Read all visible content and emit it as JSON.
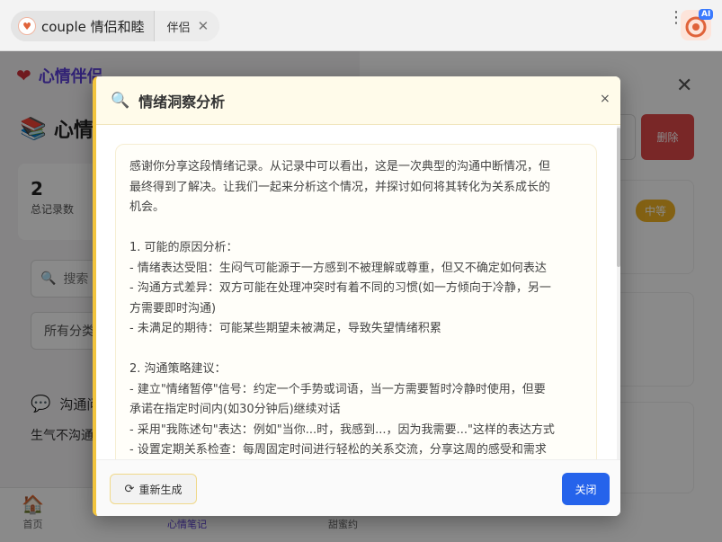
{
  "browser": {
    "tab_title": "couple 情侣和睦",
    "tab2_label": "伴侣",
    "tab_close_glyph": "✕",
    "menu_glyph": "⋮",
    "ai_badge": "AI"
  },
  "app": {
    "brand": "心情伴侣",
    "page_heading": "心情",
    "stats": {
      "total_value": "2",
      "total_label": "总记录数"
    },
    "search_placeholder": "搜索",
    "filter_value": "所有分类",
    "entry": {
      "title": "沟通问",
      "preview": "生气不沟通"
    },
    "nav": {
      "home": "首页",
      "notes": "心情笔记",
      "sweet": "甜蜜约"
    },
    "delete_label": "删除",
    "level_badge": "中等"
  },
  "modal": {
    "title": "情绪洞察分析",
    "close_glyph": "×",
    "paragraphs": [
      "感谢你分享这段情绪记录。从记录中可以看出，这是一次典型的沟通中断情况，但",
      "最终得到了解决。让我们一起来分析这个情况，并探讨如何将其转化为关系成长的",
      "机会。",
      "",
      "1. 可能的原因分析：",
      "- 情绪表达受阻：生闷气可能源于一方感到不被理解或尊重，但又不确定如何表达",
      "- 沟通方式差异：双方可能在处理冲突时有着不同的习惯(如一方倾向于冷静，另一",
      "方需要即时沟通)",
      "- 未满足的期待：可能某些期望未被满足，导致失望情绪积累",
      "",
      "2. 沟通策略建议：",
      "- 建立\"情绪暂停\"信号：约定一个手势或词语，当一方需要暂时冷静时使用，但要",
      "承诺在指定时间内(如30分钟后)继续对话",
      "- 采用\"我陈述句\"表达：例如\"当你...时，我感到...，因为我需要...\"这样的表达方式",
      "- 设置定期关系检查：每周固定时间进行轻松的关系交流，分享这周的感受和需求"
    ],
    "regenerate_label": "重新生成",
    "close_label": "关闭"
  }
}
